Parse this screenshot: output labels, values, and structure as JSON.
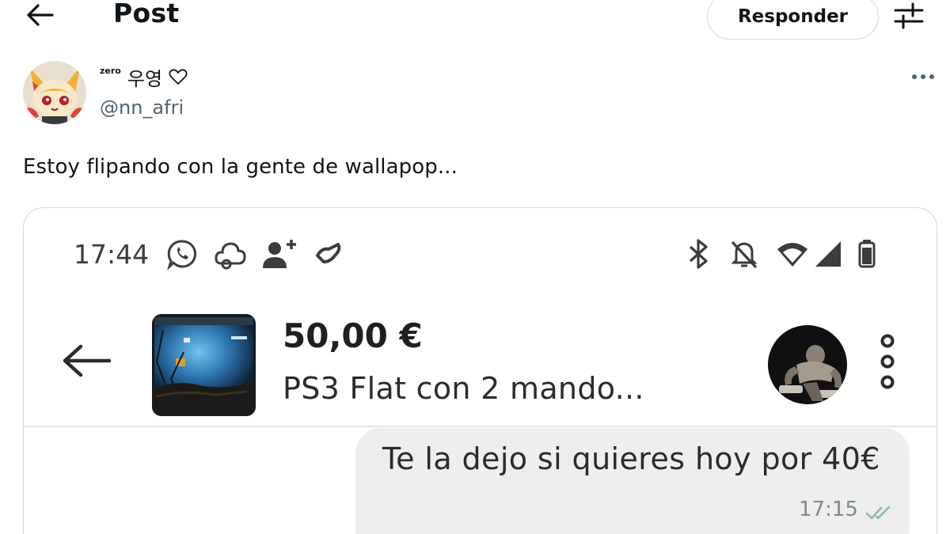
{
  "header": {
    "back_icon": "arrow-left-icon",
    "title": "Post",
    "reply_label": "Responder",
    "filter_icon": "sliders-icon"
  },
  "author": {
    "name_prefix": "zero",
    "name": "우영",
    "heart_icon": "heart-outline-icon",
    "handle": "@nn_afri",
    "more_icon": "more-horizontal-icon"
  },
  "post": {
    "text": "Estoy flipando con la gente de wallapop..."
  },
  "screenshot": {
    "status_bar": {
      "time": "17:44",
      "left_icons": [
        "whatsapp-icon",
        "cloud-icon",
        "person-add-icon",
        "wallapop-icon"
      ],
      "right_icons": [
        "bluetooth-icon",
        "bell-off-icon",
        "wifi-icon",
        "signal-icon",
        "battery-icon"
      ]
    },
    "chat_header": {
      "back_icon": "arrow-left-icon",
      "price": "50,00 €",
      "item_title": "PS3 Flat con 2 mando...",
      "kebab_icon": "more-vertical-icon"
    },
    "message": {
      "text": "Te la dejo si quieres hoy por 40€",
      "time": "17:15",
      "status_icon": "double-check-icon",
      "status_color": "#8fb8a8"
    }
  },
  "colors": {
    "border": "#cfd9de",
    "secondary_text": "#536471",
    "bubble": "#eeeeee"
  }
}
